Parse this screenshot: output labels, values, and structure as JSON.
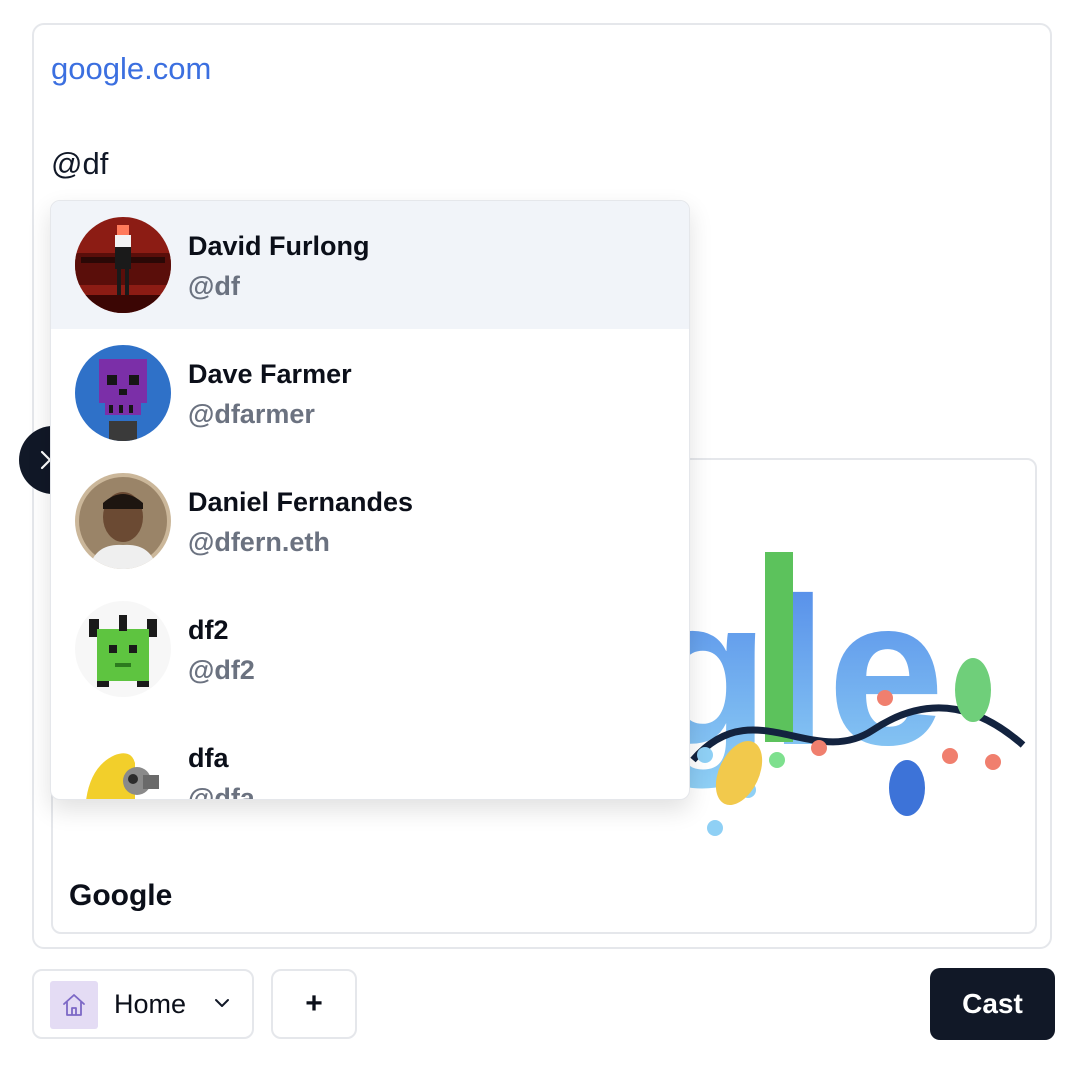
{
  "composer": {
    "link": "google.com",
    "mention": "@df"
  },
  "embed": {
    "title": "Google",
    "image_text": "gle"
  },
  "mention_suggestions": [
    {
      "name": "David Furlong",
      "handle": "@df",
      "avatar": "pixel-figure-red",
      "active": true
    },
    {
      "name": "Dave Farmer",
      "handle": "@dfarmer",
      "avatar": "purple-skull-blue"
    },
    {
      "name": "Daniel Fernandes",
      "handle": "@dfern.eth",
      "avatar": "portrait-photo"
    },
    {
      "name": "df2",
      "handle": "@df2",
      "avatar": "green-pixel-creature"
    },
    {
      "name": "dfa",
      "handle": "@dfa",
      "avatar": "yellow-hazmat-figure"
    }
  ],
  "toolbar": {
    "channel_label": "Home",
    "channel_icon": "home-icon",
    "add_label": "+",
    "cast_label": "Cast"
  },
  "colors": {
    "link": "#3b6fe0",
    "primary_button": "#111827",
    "active_option": "#f1f4f9",
    "muted_text": "#6b7280"
  }
}
